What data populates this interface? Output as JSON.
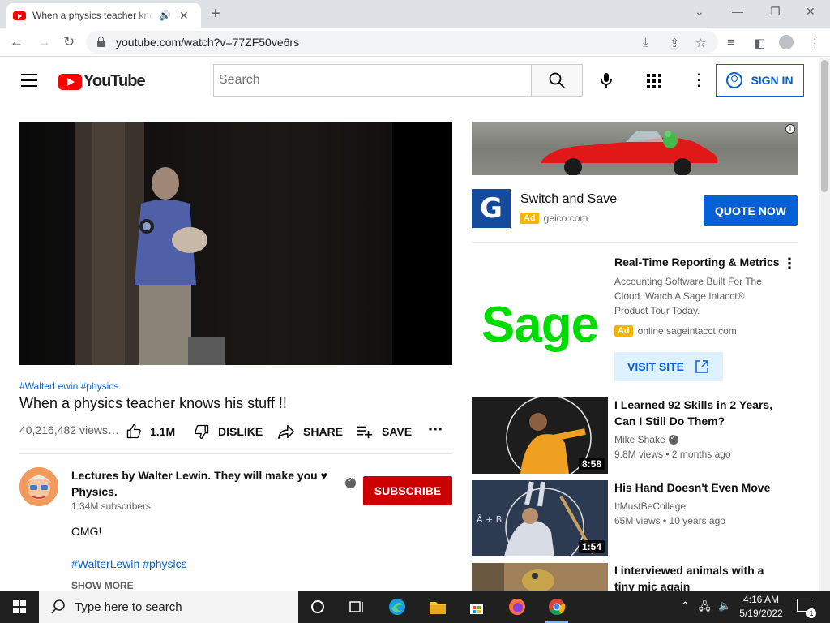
{
  "browser": {
    "tab_title": "When a physics teacher knows his stuff !!",
    "url": "youtube.com/watch?v=77ZF50ve6rs"
  },
  "youtube": {
    "logo_text": "YouTube",
    "search_placeholder": "Search",
    "sign_in_label": "SIGN IN"
  },
  "video": {
    "hashtags": "#WalterLewin #physics",
    "title": "When a physics teacher knows his stuff !!",
    "views": "40,216,482 views…",
    "like_count": "1.1M",
    "dislike_label": "DISLIKE",
    "share_label": "SHARE",
    "save_label": "SAVE",
    "channel_name": "Lectures by Walter Lewin. They will make you ♥ Physics.",
    "subscribers": "1.34M subscribers",
    "subscribe_label": "SUBSCRIBE",
    "description": "OMG!",
    "description_tags": "#WalterLewin #physics",
    "show_more_label": "SHOW MORE"
  },
  "ads": [
    {
      "title": "Switch and Save",
      "badge": "Ad",
      "domain": "geico.com",
      "cta": "QUOTE NOW",
      "logo_letter": "G"
    },
    {
      "title": "Real-Time Reporting & Metrics",
      "description": "Accounting Software Built For The Cloud. Watch A Sage Intacct® Product Tour Today.",
      "badge": "Ad",
      "domain": "online.sageintacct.com",
      "cta": "VISIT SITE",
      "logo_text": "Sage"
    }
  ],
  "related": [
    {
      "title": "I Learned 92 Skills in 2 Years, Can I Still Do Them?",
      "channel": "Mike Shake",
      "verified": true,
      "meta": "9.8M views • 2 months ago",
      "duration": "8:58"
    },
    {
      "title": "His Hand Doesn't Even Move",
      "channel": "ItMustBeCollege",
      "verified": false,
      "meta": "65M views • 10 years ago",
      "duration": "1:54"
    },
    {
      "title": "I interviewed animals with a tiny mic again",
      "channel": "",
      "meta": "",
      "duration": ""
    }
  ],
  "taskbar": {
    "search_placeholder": "Type here to search",
    "time": "4:16 AM",
    "date": "5/19/2022",
    "notification_count": "1"
  },
  "colors": {
    "youtube_red": "#ff0000",
    "link_blue": "#065fd4",
    "subscribe_red": "#cc0000",
    "ad_badge": "#f4b400",
    "sage_green": "#00dc00",
    "geico_blue": "#154b9c"
  }
}
